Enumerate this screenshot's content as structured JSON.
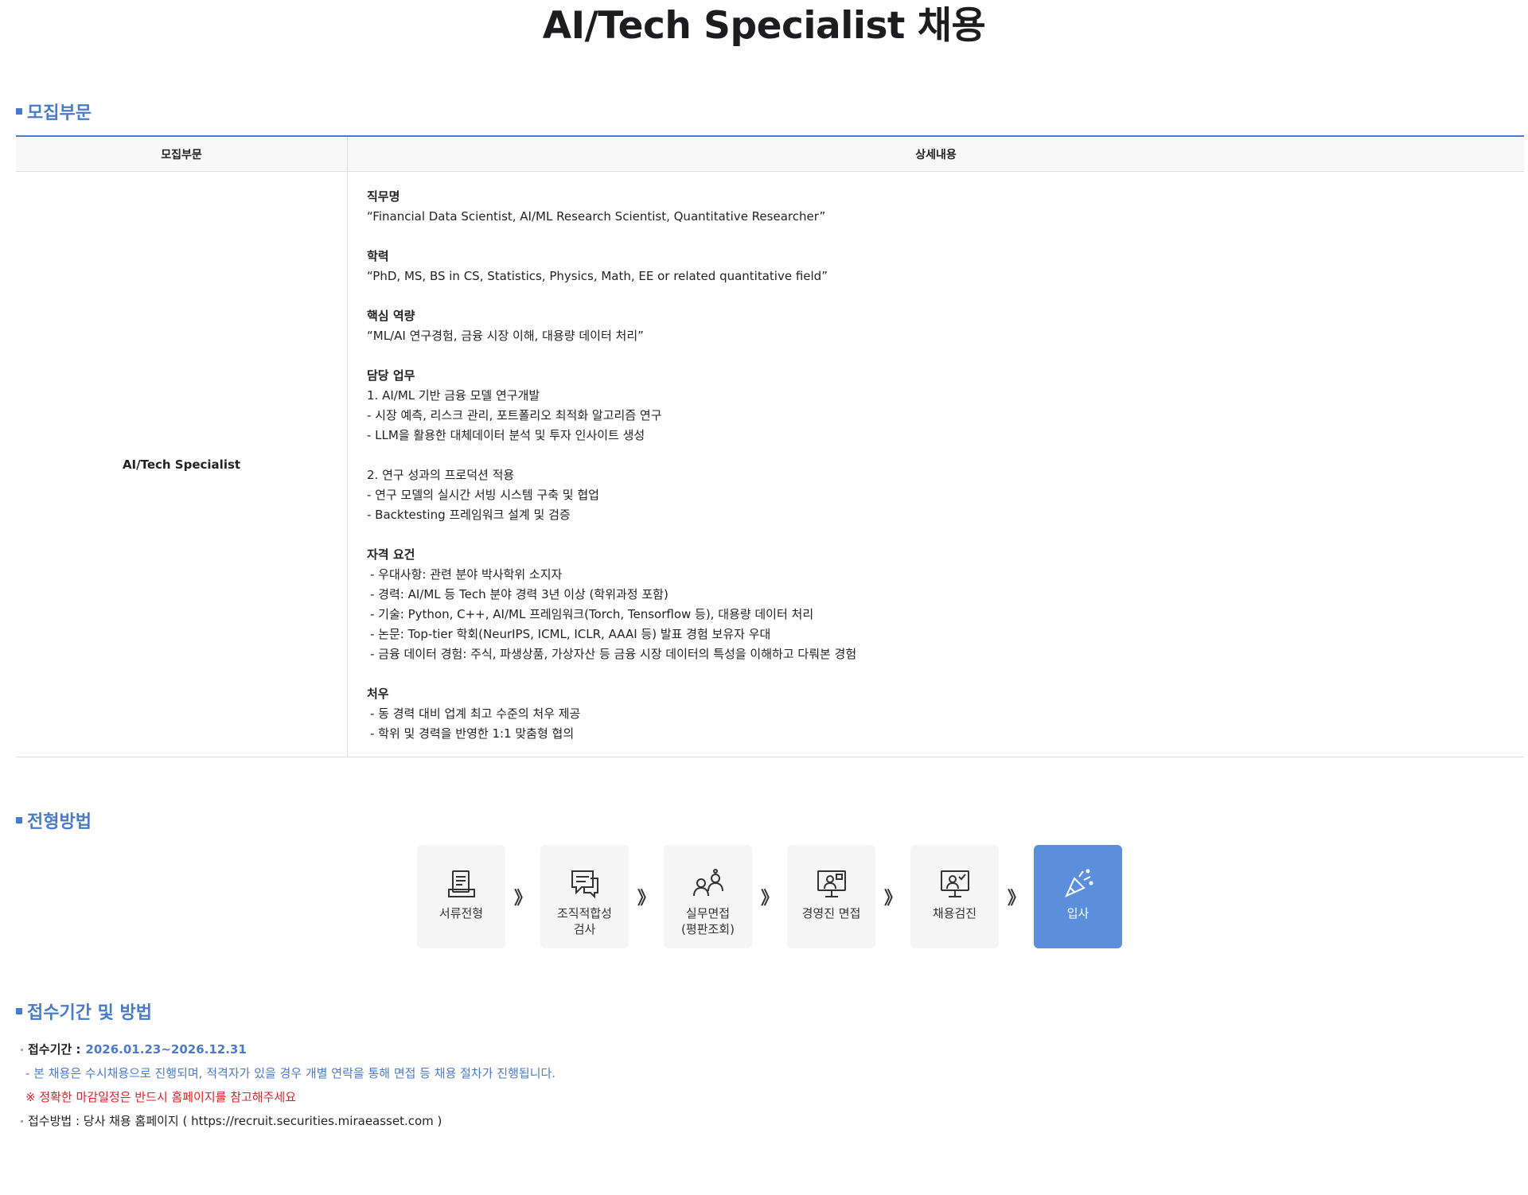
{
  "title": "AI/Tech Specialist 채용",
  "sections": {
    "recruit": "모집부문",
    "process": "전형방법",
    "apply": "접수기간 및 방법"
  },
  "table": {
    "headers": [
      "모집부문",
      "상세내용"
    ],
    "division": "AI/Tech Specialist",
    "job_label": "직무명",
    "job_value": "“Financial Data Scientist, AI/ML Research Scientist, Quantitative Researcher”",
    "edu_label": "학력",
    "edu_value": "“PhD, MS, BS in CS, Statistics, Physics, Math, EE or related quantitative field”",
    "core_label": "핵심 역량",
    "core_value": "“ML/AI 연구경험, 금융 시장 이해, 대용량 데이터 처리”",
    "duty_label": "담당 업무",
    "duty_lines": [
      "1. AI/ML 기반 금융 모델 연구개발",
      "- 시장 예측, 리스크 관리, 포트폴리오 최적화 알고리즘 연구",
      "- LLM을 활용한 대체데이터 분석 및 투자 인사이트 생성"
    ],
    "duty_lines2": [
      "2. 연구 성과의 프로덕션 적용",
      "- 연구 모델의 실시간 서빙 시스템 구축 및 협업",
      "- Backtesting 프레임워크 설계 및 검증"
    ],
    "qual_label": "자격 요건",
    "qual_lines": [
      "- 우대사항: 관련 분야 박사학위 소지자",
      "- 경력: AI/ML 등 Tech 분야 경력 3년 이상 (학위과정 포함)",
      "- 기술: Python, C++, AI/ML 프레임워크(Torch, Tensorflow 등), 대용량 데이터 처리",
      "- 논문: Top-tier 학회(NeurIPS, ICML, ICLR, AAAI 등) 발표 경험 보유자 우대",
      "- 금융 데이터 경험: 주식, 파생상품, 가상자산 등 금융 시장 데이터의 특성을 이해하고 다뤄본 경험"
    ],
    "benefit_label": "처우",
    "benefit_lines": [
      "- 동 경력 대비 업계 최고 수준의 처우 제공",
      "- 학위 및 경력을 반영한 1:1 맞춤형 협의"
    ]
  },
  "process": {
    "arrow": "》",
    "steps": [
      {
        "label": "서류전형",
        "icon": "document-icon"
      },
      {
        "label": "조직적합성\n검사",
        "icon": "chat-form-icon"
      },
      {
        "label": "실무면접\n(평판조회)",
        "icon": "people-icon"
      },
      {
        "label": "경영진 면접",
        "icon": "monitor-person-icon"
      },
      {
        "label": "채용검진",
        "icon": "monitor-check-icon"
      },
      {
        "label": "입사",
        "icon": "party-icon"
      }
    ],
    "active_color": "#5b8fdc"
  },
  "apply": {
    "period_label": "접수기간 :",
    "period_value": "2026.01.23~2026.12.31",
    "note": "- 본 채용은 수시채용으로 진행되며, 적격자가 있을 경우 개별 연락을 통해 면접 등 채용 절차가 진행됩니다.",
    "warning": "※ 정확한 마감일정은 반드시 홈페이지를 참고해주세요",
    "method": "접수방법 : 당사 채용 홈페이지 ( https://recruit.securities.miraeasset.com )"
  },
  "colors": {
    "accent": "#4a7bc8",
    "warning": "#d9252b"
  }
}
